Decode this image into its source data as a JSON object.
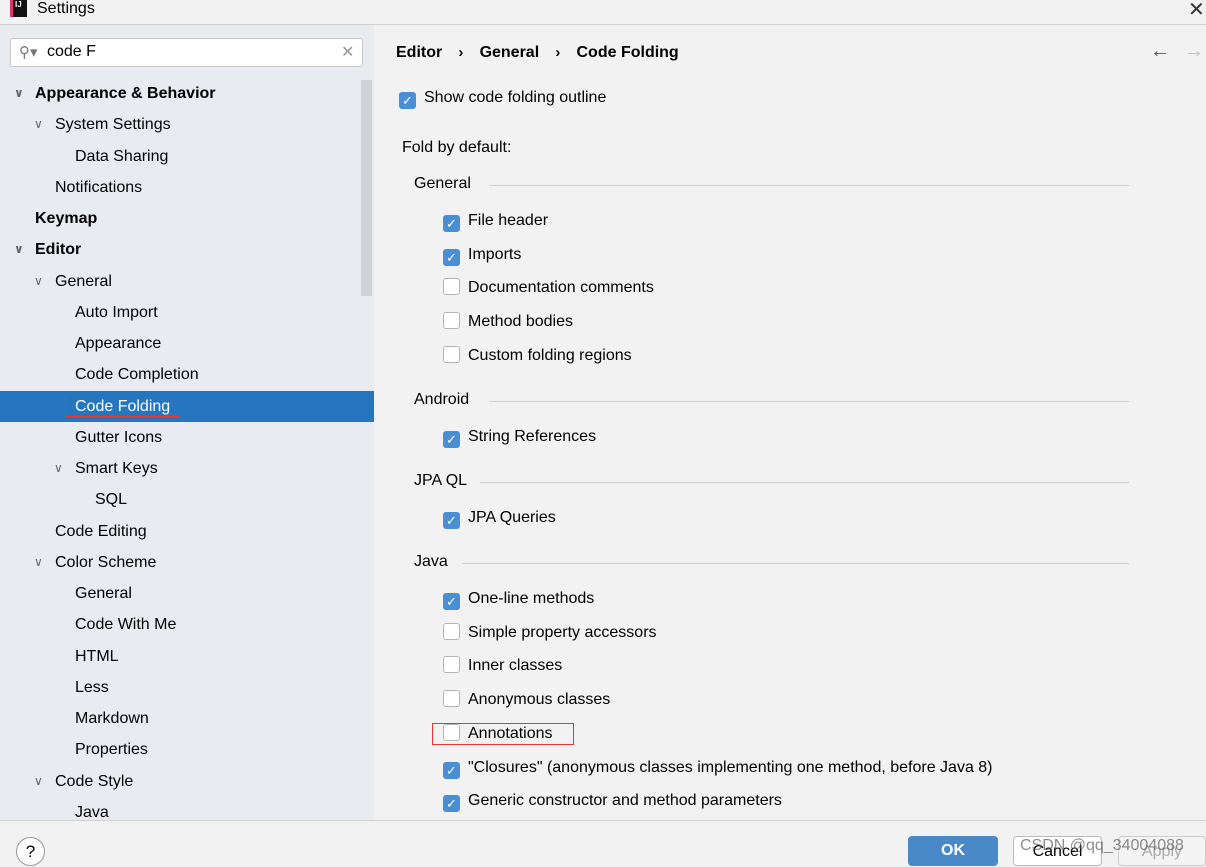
{
  "window": {
    "title": "Settings",
    "logo_text": "IJ"
  },
  "search": {
    "value": "code F"
  },
  "tree": [
    {
      "label": "Appearance & Behavior",
      "level": 0,
      "bold": true,
      "arrow": true
    },
    {
      "label": "System Settings",
      "level": 1,
      "arrow": true
    },
    {
      "label": "Data Sharing",
      "level": 2
    },
    {
      "label": "Notifications",
      "level": 1
    },
    {
      "label": "Keymap",
      "level": 0,
      "bold": true
    },
    {
      "label": "Editor",
      "level": 0,
      "bold": true,
      "arrow": true
    },
    {
      "label": "General",
      "level": 1,
      "arrow": true
    },
    {
      "label": "Auto Import",
      "level": 2
    },
    {
      "label": "Appearance",
      "level": 2
    },
    {
      "label": "Code Completion",
      "level": 2
    },
    {
      "label": "Code Folding",
      "level": 2,
      "selected": true
    },
    {
      "label": "Gutter Icons",
      "level": 2
    },
    {
      "label": "Smart Keys",
      "level": 2,
      "arrow": true
    },
    {
      "label": "SQL",
      "level": 3
    },
    {
      "label": "Code Editing",
      "level": 1
    },
    {
      "label": "Color Scheme",
      "level": 1,
      "arrow": true
    },
    {
      "label": "General",
      "level": 2
    },
    {
      "label": "Code With Me",
      "level": 2
    },
    {
      "label": "HTML",
      "level": 2
    },
    {
      "label": "Less",
      "level": 2
    },
    {
      "label": "Markdown",
      "level": 2
    },
    {
      "label": "Properties",
      "level": 2
    },
    {
      "label": "Code Style",
      "level": 1,
      "arrow": true
    },
    {
      "label": "Java",
      "level": 2
    }
  ],
  "breadcrumb": [
    "Editor",
    "General",
    "Code Folding"
  ],
  "show_outline": {
    "label": "Show code folding outline",
    "checked": true
  },
  "fold_by_default": "Fold by default:",
  "sections": [
    {
      "title": "General",
      "items": [
        {
          "label": "File header",
          "checked": true
        },
        {
          "label": "Imports",
          "checked": true
        },
        {
          "label": "Documentation comments",
          "checked": false
        },
        {
          "label": "Method bodies",
          "checked": false
        },
        {
          "label": "Custom folding regions",
          "checked": false
        }
      ]
    },
    {
      "title": "Android",
      "items": [
        {
          "label": "String References",
          "checked": true
        }
      ]
    },
    {
      "title": "JPA QL",
      "items": [
        {
          "label": "JPA Queries",
          "checked": true
        }
      ]
    },
    {
      "title": "Java",
      "items": [
        {
          "label": "One-line methods",
          "checked": true
        },
        {
          "label": "Simple property accessors",
          "checked": false
        },
        {
          "label": "Inner classes",
          "checked": false
        },
        {
          "label": "Anonymous classes",
          "checked": false
        },
        {
          "label": "Annotations",
          "checked": false
        },
        {
          "label": "\"Closures\" (anonymous classes implementing one method, before Java 8)",
          "checked": true
        },
        {
          "label": "Generic constructor and method parameters",
          "checked": true
        }
      ]
    }
  ],
  "footer": {
    "help": "?",
    "ok": "OK",
    "cancel": "Cancel",
    "apply": "Apply",
    "watermark": "CSDN @qq_34004088"
  },
  "colors": {
    "accent": "#2675bf",
    "checkbox": "#4a8fd6",
    "highlight": "#e33"
  }
}
